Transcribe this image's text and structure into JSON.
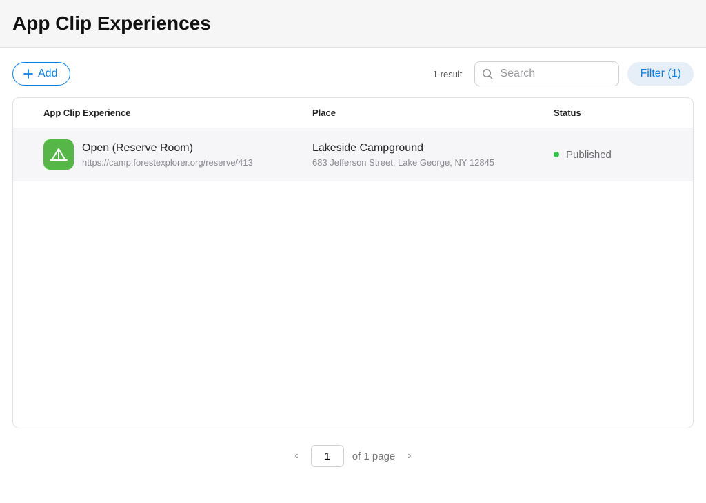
{
  "header": {
    "title": "App Clip Experiences"
  },
  "toolbar": {
    "add_label": "Add",
    "result_count_text": "1 result",
    "search_placeholder": "Search",
    "filter_label": "Filter (1)"
  },
  "table": {
    "columns": {
      "experience": "App Clip Experience",
      "place": "Place",
      "status": "Status"
    },
    "rows": [
      {
        "icon": "tent-icon",
        "icon_bg": "#57b648",
        "title": "Open (Reserve Room)",
        "url": "https://camp.forestexplorer.org/reserve/413",
        "place_name": "Lakeside Campground",
        "place_address": "683 Jefferson Street, Lake George, NY 12845",
        "status_label": "Published",
        "status_color": "#35c24a"
      }
    ]
  },
  "pagination": {
    "current": "1",
    "suffix": "of 1 page"
  }
}
